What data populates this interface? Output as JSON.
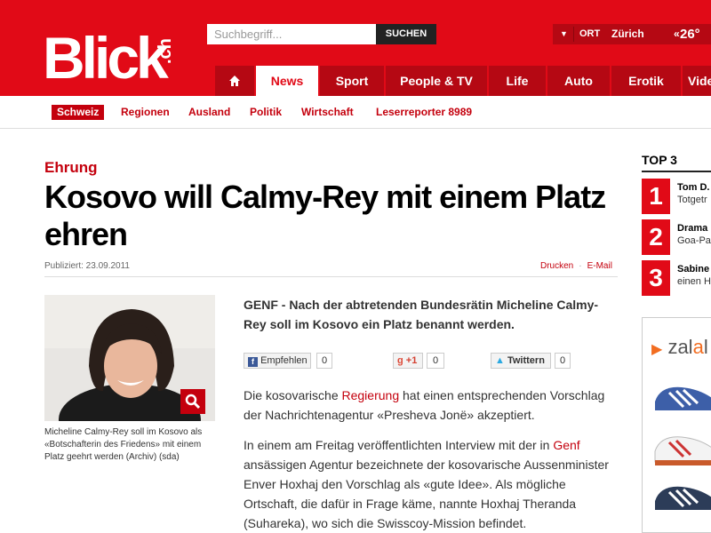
{
  "header": {
    "logo": "Blick",
    "logo_suffix": ".ch",
    "search_placeholder": "Suchbegriff...",
    "search_button": "SUCHEN",
    "weather": {
      "ort_label": "ORT",
      "city": "Zürich",
      "temperature": "26°"
    },
    "nav": [
      "News",
      "Sport",
      "People & TV",
      "Life",
      "Auto",
      "Erotik",
      "Vide"
    ],
    "home_icon": "home-icon"
  },
  "subnav": [
    "Schweiz",
    "Regionen",
    "Ausland",
    "Politik",
    "Wirtschaft",
    "Leserreporter 8989"
  ],
  "article": {
    "kicker": "Ehrung",
    "headline": "Kosovo will Calmy-Rey mit einem Platz ehren",
    "published": "Publiziert: 23.09.2011",
    "print": "Drucken",
    "email": "E-Mail",
    "caption": "Micheline Calmy-Rey soll im Kosovo als «Botschafterin des Friedens» mit einem Platz geehrt werden (Archiv) (sda)",
    "lead": "GENF - Nach der abtretenden Bundesrätin Micheline Calmy-Rey soll im Kosovo ein Platz benannt werden.",
    "share": {
      "facebook_label": "Empfehlen",
      "facebook_count": "0",
      "google_label": "+1",
      "google_count": "0",
      "twitter_label": "Twittern",
      "twitter_count": "0"
    },
    "p1_a": "Die kosovarische ",
    "p1_link": "Regierung",
    "p1_b": " hat einen entsprechenden Vorschlag der Nachrichtenagentur «Presheva Jonë» akzeptiert.",
    "p2_a": "In einem am Freitag veröffentlichten Interview mit der in ",
    "p2_link": "Genf",
    "p2_b": " ansässigen Agentur bezeichnete der kosovarische Aussenminister Enver Hoxhaj den Vorschlag als «gute Idee». Als mögliche Ortschaft, die dafür in Frage käme, nannte Hoxhaj Theranda (Suhareka), wo sich die Swisscoy-Mission befindet."
  },
  "top3": {
    "title": "TOP 3",
    "items": [
      {
        "num": "1",
        "line1": "Tom D.",
        "line2": "Totgetr"
      },
      {
        "num": "2",
        "line1": "Drama",
        "line2": "Goa-Pa"
      },
      {
        "num": "3",
        "line1": "Sabine",
        "line2": "einen H"
      }
    ]
  },
  "ad": {
    "brand_pre": "zal",
    "brand_o": "a",
    "brand_post": "l"
  }
}
